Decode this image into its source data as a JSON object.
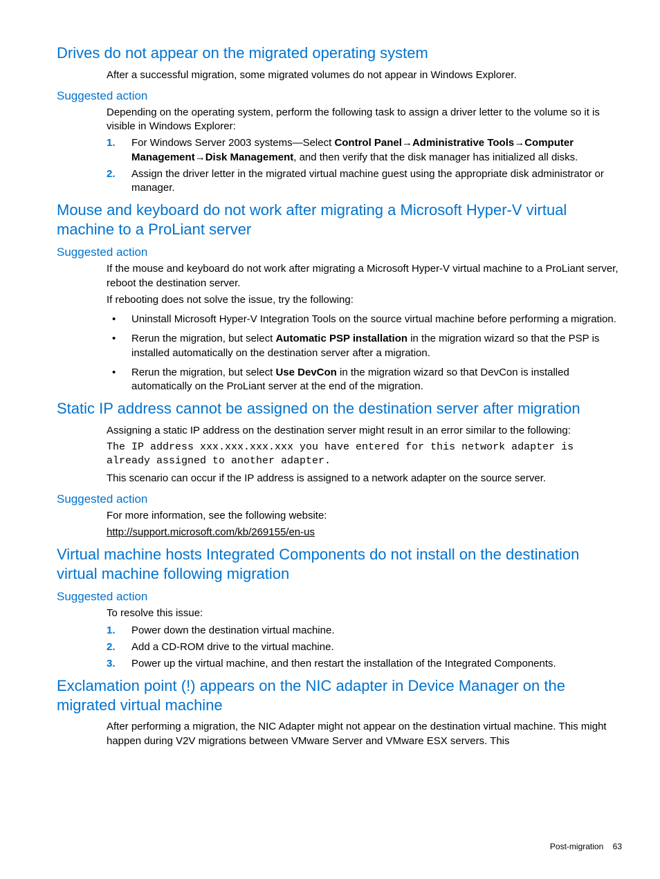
{
  "sections": [
    {
      "heading": "Drives do not appear on the migrated operating system",
      "intro": "After a successful migration, some migrated volumes do not appear in Windows Explorer.",
      "subheading": "Suggested action",
      "subintro": "Depending on the operating system, perform the following task to assign a driver letter to the volume so it is visible in Windows Explorer:",
      "ol": [
        {
          "pre": "For Windows Server 2003 systems—Select ",
          "b1": "Control Panel",
          "b2": "Administrative Tools",
          "b3": "Computer Management",
          "b4": "Disk Management",
          "post": ", and then verify that the disk manager has initialized all disks."
        },
        {
          "text": "Assign the driver letter in the migrated virtual machine guest using the appropriate disk administrator or manager."
        }
      ]
    },
    {
      "heading": "Mouse and keyboard do not work after migrating a Microsoft Hyper-V virtual machine to a ProLiant server",
      "subheading": "Suggested action",
      "p1": "If the mouse and keyboard do not work after migrating a Microsoft Hyper-V virtual machine to a ProLiant server, reboot the destination server.",
      "p2": "If rebooting does not solve the issue, try the following:",
      "ul": [
        {
          "text": "Uninstall Microsoft Hyper-V Integration Tools on the source virtual machine before performing a migration."
        },
        {
          "pre": "Rerun the migration, but select ",
          "b": "Automatic PSP installation",
          "post": " in the migration wizard so that the PSP is installed automatically on the destination server after a migration."
        },
        {
          "pre": "Rerun the migration, but select ",
          "b": "Use DevCon",
          "post": " in the migration wizard so that DevCon is installed automatically on the ProLiant server at the end of the migration."
        }
      ]
    },
    {
      "heading": "Static IP address cannot be assigned on the destination server after migration",
      "p1": "Assigning a static IP address on the destination server might result in an error similar to the following:",
      "mono": "The IP address xxx.xxx.xxx.xxx you have entered for this network adapter is already assigned to another adapter.",
      "p2": "This scenario can occur if the IP address is assigned to a network adapter on the source server.",
      "subheading": "Suggested action",
      "p3": "For more information, see the following website:",
      "link": "http://support.microsoft.com/kb/269155/en-us"
    },
    {
      "heading": "Virtual machine hosts Integrated Components do not install on the destination virtual machine following migration",
      "subheading": "Suggested action",
      "p1": "To resolve this issue:",
      "ol": [
        "Power down the destination virtual machine.",
        "Add a CD-ROM drive to the virtual machine.",
        "Power up the virtual machine, and then restart the installation of the Integrated Components."
      ]
    },
    {
      "heading": "Exclamation point (!) appears on the NIC adapter in Device Manager on the migrated virtual machine",
      "p1": "After performing a migration, the NIC Adapter might not appear on the destination virtual machine. This might happen during V2V migrations between VMware Server and VMware ESX servers. This"
    }
  ],
  "footer": {
    "label": "Post-migration",
    "page": "63"
  }
}
